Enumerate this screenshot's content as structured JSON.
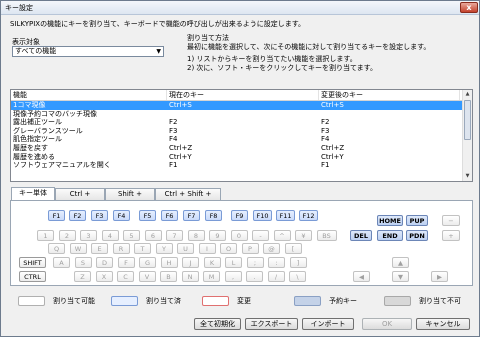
{
  "window": {
    "title": "キー設定",
    "close": "x"
  },
  "description": "SILKYPIXの機能にキーを割り当て、キーボードで機能の呼び出しが出来るように設定します。",
  "target": {
    "label": "表示対象",
    "selected": "すべての機能"
  },
  "method": {
    "header": "割り当て方法",
    "line1": "最初に機能を選択して、次にその機能に対して割り当てるキーを設定します。",
    "line2": "1) リストからキーを割り当てたい機能を選択します。",
    "line3": "2) 次に、ソフト・キーをクリックしてキーを割り当てます。"
  },
  "list": {
    "headers": [
      "機能",
      "現在のキー",
      "変更後のキー"
    ],
    "rows": [
      [
        "1コマ現像",
        "Ctrl+S",
        "Ctrl+S"
      ],
      [
        "現像予約コマのバッチ現像",
        "",
        ""
      ],
      [
        "露出補正ツール",
        "F2",
        "F2"
      ],
      [
        "グレーバランスツール",
        "F3",
        "F3"
      ],
      [
        "肌色指定ツール",
        "F4",
        "F4"
      ],
      [
        "履歴を戻す",
        "Ctrl+Z",
        "Ctrl+Z"
      ],
      [
        "履歴を進める",
        "Ctrl+Y",
        "Ctrl+Y"
      ],
      [
        "ソフトウェアマニュアルを開く",
        "F1",
        "F1"
      ]
    ]
  },
  "tabs": [
    "キー単体",
    "Ctrl +",
    "Shift +",
    "Ctrl + Shift +"
  ],
  "keys": {
    "fkeys": [
      "F1",
      "F2",
      "F3",
      "F4",
      "F5",
      "F6",
      "F7",
      "F8",
      "F9",
      "F10",
      "F11",
      "F12"
    ],
    "row_num": [
      "1",
      "2",
      "3",
      "4",
      "5",
      "6",
      "7",
      "8",
      "9",
      "0",
      "-",
      "^",
      "¥",
      "BS"
    ],
    "row_q": [
      "Q",
      "W",
      "E",
      "R",
      "T",
      "Y",
      "U",
      "I",
      "O",
      "P",
      "@",
      "["
    ],
    "row_a": [
      "A",
      "S",
      "D",
      "F",
      "G",
      "H",
      "J",
      "K",
      "L",
      ";",
      ":",
      "]"
    ],
    "row_z": [
      "Z",
      "X",
      "C",
      "V",
      "B",
      "N",
      "M",
      ",",
      ".",
      "/",
      "\\"
    ],
    "shift": "SHIFT",
    "ctrl": "CTRL",
    "home": "HOME",
    "pup": "PUP",
    "del": "DEL",
    "end": "END",
    "pdn": "PDN",
    "minus": "−",
    "plus": "+",
    "arrow_up": "▲",
    "arrow_left": "◀",
    "arrow_down": "▼",
    "arrow_right": "▶"
  },
  "legend": [
    "割り当て可能",
    "割り当て済",
    "変更",
    "予約キー",
    "割り当て不可"
  ],
  "buttons": {
    "reset": "全て初期化",
    "export": "エクスポート",
    "import": "インポート",
    "ok": "OK",
    "cancel": "キャンセル"
  },
  "colors": {
    "selection": "#3399ff",
    "assigned": "#c9dafa",
    "changed": "#f2a2a2",
    "reserved": "#b8c8e0",
    "unavailable": "#d8d8d8"
  }
}
